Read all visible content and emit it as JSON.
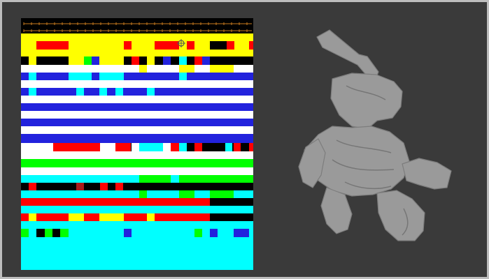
{
  "app": {
    "colors": {
      "window_frame": "#bdbdbd",
      "background": "#3a3a3a",
      "ruler": "#000000",
      "ruler_ticks": "#c87a1e",
      "yellow": "#ffff00",
      "red": "#ff0000",
      "black": "#000000",
      "white": "#ffffff",
      "blue": "#2222dd",
      "cyan": "#00ffff",
      "green": "#00ff00",
      "darkred": "#aa1a1a",
      "model_gray": "#9a9a9a"
    }
  },
  "timeline": {
    "cursor_icon": "crosshair-cursor-icon",
    "track_count": 30
  },
  "viewport": {
    "model_icon": "3d-character-model-icon"
  }
}
